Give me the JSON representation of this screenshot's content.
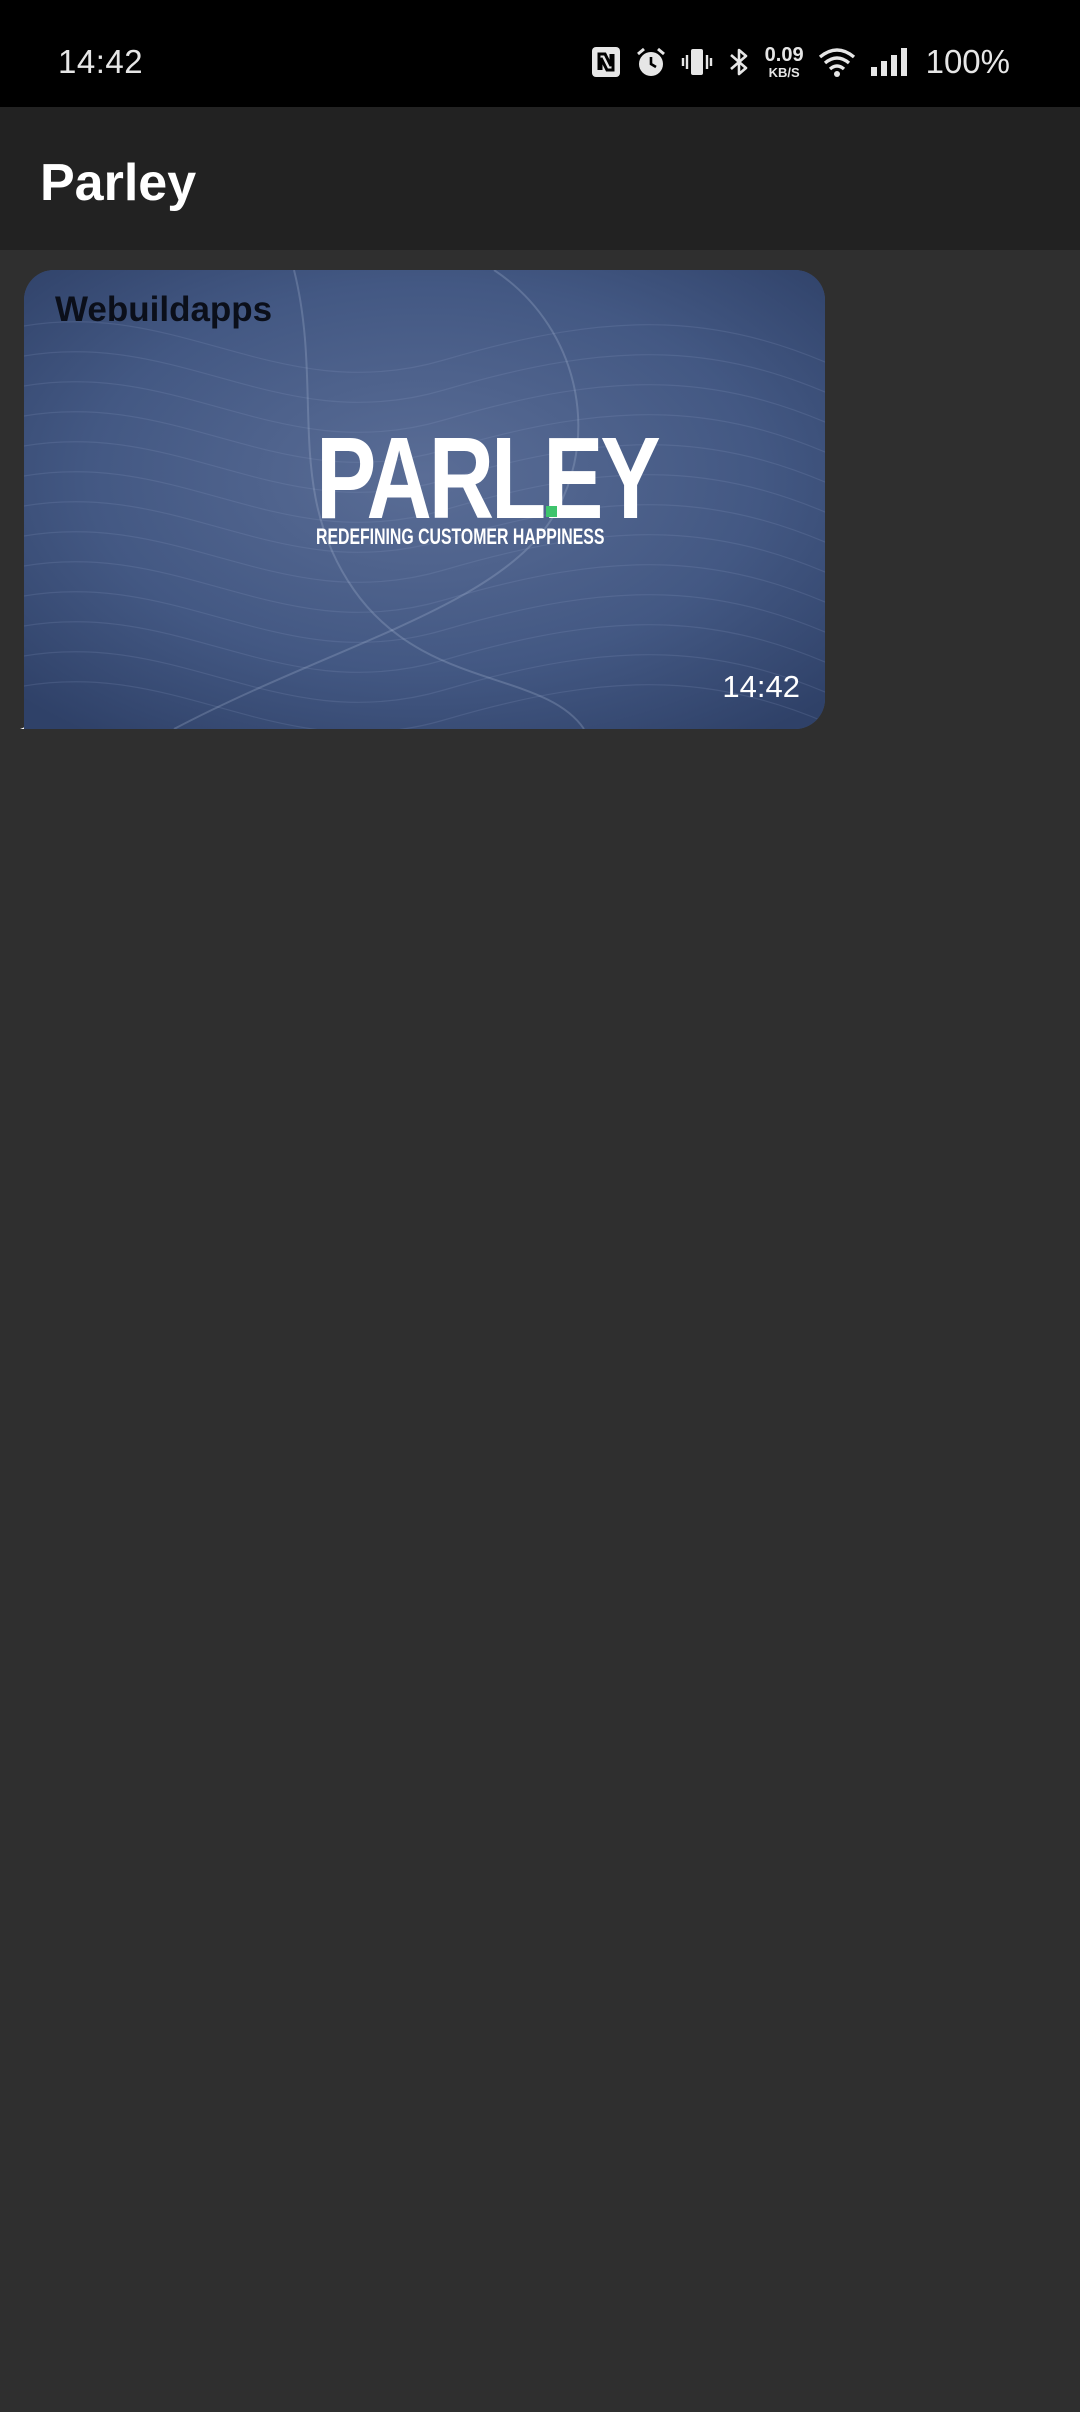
{
  "status_bar": {
    "time": "14:42",
    "net_speed_value": "0.09",
    "net_speed_unit": "KB/S",
    "battery": "100%",
    "icons": [
      "nfc-icon",
      "alarm-icon",
      "vibrate-icon",
      "bluetooth-icon",
      "wifi-icon",
      "signal-icon"
    ]
  },
  "app_bar": {
    "title": "Parley"
  },
  "messages": [
    {
      "sender": "Webuildapps",
      "media": {
        "brand": "PARLEY",
        "brand_dot": ".",
        "tagline": "REDEFINING CUSTOMER HAPPINESS"
      },
      "time": "14:42"
    }
  ],
  "colors": {
    "status_bar_bg": "#000000",
    "app_bar_bg": "#222222",
    "chat_bg": "#2f2f2f",
    "media_bg": "#3d5078",
    "brand_dot": "#3ec46d"
  }
}
